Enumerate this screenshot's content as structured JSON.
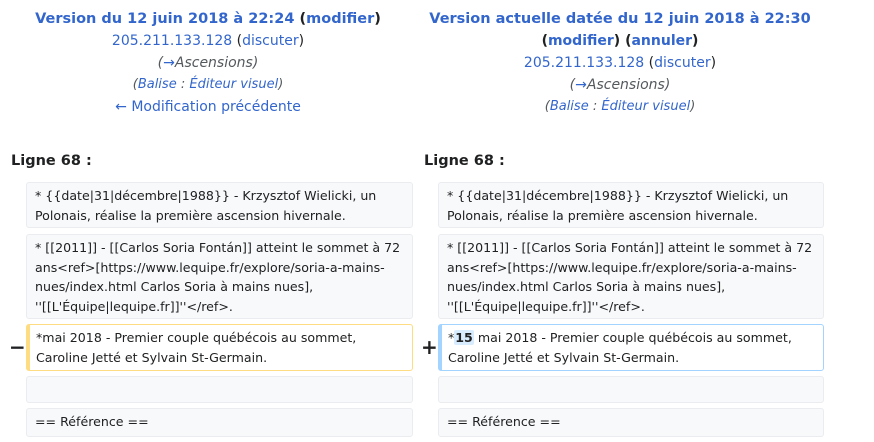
{
  "left_header": {
    "title": "Version du 12 juin 2018 à 22:24",
    "edit_link": "modifier",
    "user": "205.211.133.128",
    "talk": "discuter",
    "summary_arrow": "→",
    "summary_section": "Ascensions",
    "tag_label": "Balise",
    "tag_sep": " : ",
    "tag_value": "Éditeur visuel",
    "prev_link": "← Modification précédente"
  },
  "right_header": {
    "title": "Version actuelle datée du 12 juin 2018 à 22:30",
    "edit_link": "modifier",
    "undo_link": "annuler",
    "user": "205.211.133.128",
    "talk": "discuter",
    "summary_arrow": "→",
    "summary_section": "Ascensions",
    "tag_label": "Balise",
    "tag_sep": " : ",
    "tag_value": "Éditeur visuel"
  },
  "line_label": "Ligne 68 :",
  "rows": {
    "wielicki": "* {{date|31|décembre|1988}} - Krzysztof Wielicki, un Polonais, réalise la première ascension hivernale.",
    "soria": "* [[2011]] - [[Carlos Soria Fontán]] atteint le sommet à 72 ans<ref>[https://www.lequipe.fr/explore/soria-a-mains-nues/index.html Carlos Soria à mains nues], ''[[L'Équipe|lequipe.fr]]''</ref>.",
    "ref": "== Référence =="
  },
  "changed": {
    "del_marker": "−",
    "add_marker": "+",
    "old_text": "*mai 2018 - Premier couple québécois au sommet, Caroline Jetté et Sylvain St-Germain.",
    "new_prefix": "*",
    "new_inserted": "15",
    "new_rest": " mai 2018 - Premier couple québécois au sommet, Caroline Jetté et Sylvain St-Germain."
  }
}
